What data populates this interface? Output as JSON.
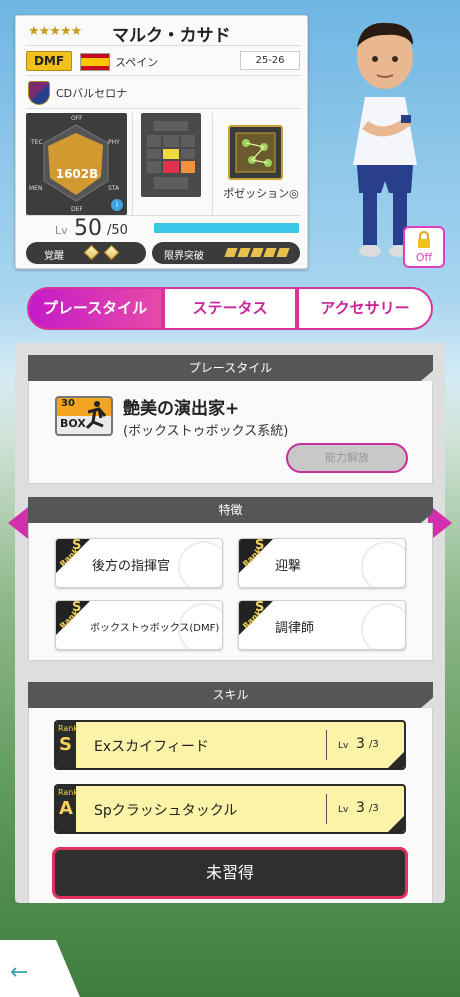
{
  "player": {
    "stars": "★★★★★",
    "name": "マルク・カサド",
    "position": "DMF",
    "country": "スペイン",
    "season": "25-26",
    "club": "CDバルセロナ",
    "overall": "1602B",
    "stat_labels": [
      "OFF",
      "TEC",
      "PHY",
      "MEN",
      "STA",
      "DEF"
    ],
    "position_label": "ポゼッション◎",
    "level_label": "Lv",
    "level": "50",
    "level_max": "/50",
    "level_progress": 1.0,
    "awakening_label": "覚醒",
    "awakening_count": 2,
    "limit_break_label": "限界突破",
    "limit_break_count": 5,
    "lock_label": "Off"
  },
  "tabs": [
    {
      "label": "プレースタイル",
      "active": true
    },
    {
      "label": "ステータス",
      "active": false
    },
    {
      "label": "アクセサリー",
      "active": false
    }
  ],
  "playstyle": {
    "header": "プレースタイル",
    "icon_number": "30",
    "icon_text": "BOX",
    "title": "艶美の演出家+",
    "subtitle": "(ボックストゥボックス系統)",
    "button": "能力解放"
  },
  "traits": {
    "header": "特徴",
    "rank_label": "Rank",
    "items": [
      {
        "rank": "S",
        "name": "後方の指揮官"
      },
      {
        "rank": "S",
        "name": "迎撃"
      },
      {
        "rank": "S",
        "name": "ボックストゥボックス(DMF)"
      },
      {
        "rank": "S",
        "name": "調律師"
      }
    ]
  },
  "skills": {
    "header": "スキル",
    "rank_label": "Rank",
    "lv_label": "Lv",
    "items": [
      {
        "rank": "S",
        "name": "Exスカイフィード",
        "lv": "3",
        "lv_max": "/3"
      },
      {
        "rank": "A",
        "name": "Spクラッシュタックル",
        "lv": "3",
        "lv_max": "/3"
      }
    ]
  },
  "learn_button": "未習得",
  "colors": {
    "accent": "#d9339e",
    "gold": "#f2c01c",
    "bar": "#39c7e8"
  },
  "icons": [
    "lock-icon",
    "back-arrow-icon",
    "left-arrow-icon",
    "right-arrow-icon",
    "club-crest-icon",
    "spain-flag-icon"
  ]
}
